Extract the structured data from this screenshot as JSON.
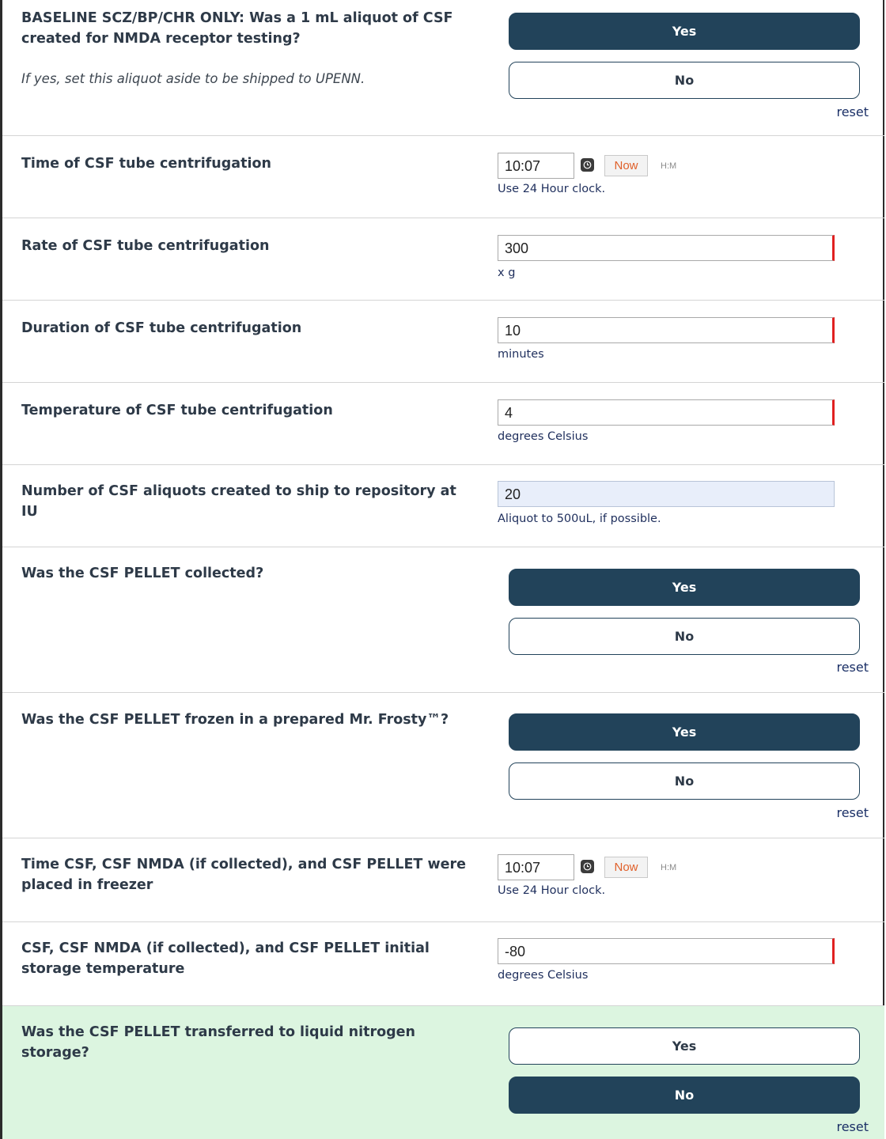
{
  "q_nmda": {
    "label": "BASELINE SCZ/BP/CHR ONLY: Was a 1 mL aliquot of CSF created for NMDA receptor testing?",
    "note": "If yes, set this aliquot aside to be shipped to UPENN.",
    "yes": "Yes",
    "no": "No",
    "selected": "Yes",
    "reset": "reset"
  },
  "q_time_centrifugation": {
    "label": "Time of CSF tube centrifugation",
    "value": "10:07",
    "now": "Now",
    "format": "H:M",
    "help": "Use 24 Hour clock."
  },
  "q_rate": {
    "label": "Rate of CSF tube centrifugation",
    "value": "300",
    "unit": "x g"
  },
  "q_duration": {
    "label": "Duration of CSF tube centrifugation",
    "value": "10",
    "unit": "minutes"
  },
  "q_temperature": {
    "label": "Temperature of CSF tube centrifugation",
    "value": "4",
    "unit": "degrees Celsius"
  },
  "q_aliquots": {
    "label": "Number of CSF aliquots created to ship to repository at IU",
    "value": "20",
    "help": "Aliquot to 500uL, if possible."
  },
  "q_pellet_collected": {
    "label": "Was the CSF PELLET collected?",
    "yes": "Yes",
    "no": "No",
    "selected": "Yes",
    "reset": "reset"
  },
  "q_pellet_frozen": {
    "label": "Was the CSF PELLET frozen in a prepared Mr. Frosty™?",
    "yes": "Yes",
    "no": "No",
    "selected": "Yes",
    "reset": "reset"
  },
  "q_time_freezer": {
    "label": "Time CSF, CSF NMDA (if collected), and CSF PELLET were placed in freezer",
    "value": "10:07",
    "now": "Now",
    "format": "H:M",
    "help": "Use 24 Hour clock."
  },
  "q_storage_temp": {
    "label": "CSF, CSF NMDA (if collected), and CSF PELLET initial storage temperature",
    "value": "-80",
    "unit": "degrees Celsius"
  },
  "q_liquid_nitrogen": {
    "label": "Was the CSF PELLET transferred to liquid nitrogen storage?",
    "yes": "Yes",
    "no": "No",
    "selected": "No",
    "reset": "reset"
  },
  "colors": {
    "selected_button": "#22435a",
    "required_marker": "#e02020",
    "highlight_row": "#dcf5e0",
    "now_text": "#e0602a"
  }
}
